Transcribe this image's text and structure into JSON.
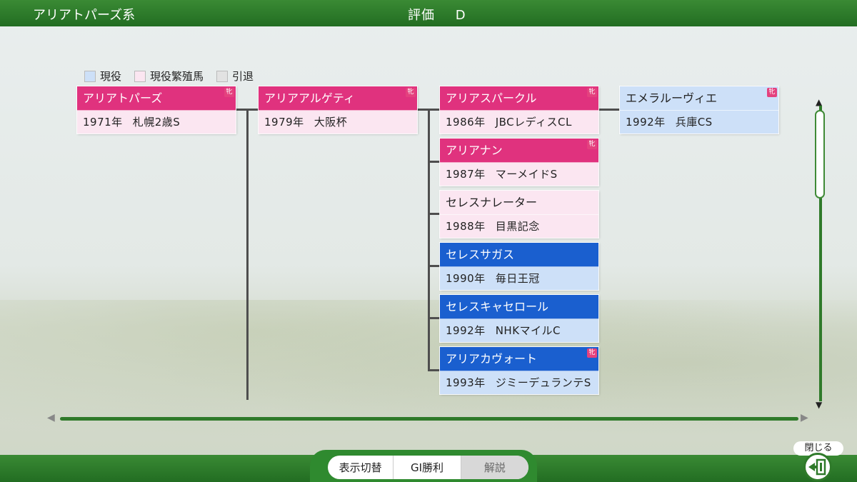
{
  "header": {
    "title": "アリアトパーズ系",
    "rating_label": "評価",
    "rating_grade": "D"
  },
  "legend": [
    {
      "label": "現役",
      "color": "#cde0f8"
    },
    {
      "label": "現役繁殖馬",
      "color": "#fbe6f1"
    },
    {
      "label": "引退",
      "color": "#e2e2e2"
    }
  ],
  "horses": [
    {
      "name": "アリアトパーズ",
      "year": "1971年",
      "race": "札幌2歳S",
      "status": "breeding",
      "badge": "牝"
    },
    {
      "name": "アリアアルゲティ",
      "year": "1979年",
      "race": "大阪杯",
      "status": "breeding",
      "badge": "牝"
    },
    {
      "name": "アリアスパークル",
      "year": "1986年",
      "race": "JBCレディスCL",
      "status": "breeding",
      "badge": "牝"
    },
    {
      "name": "エメラルーヴィエ",
      "year": "1992年",
      "race": "兵庫CS",
      "status": "active",
      "badge": "牝"
    },
    {
      "name": "アリアナン",
      "year": "1987年",
      "race": "マーメイドS",
      "status": "breeding",
      "badge": "牝"
    },
    {
      "name": "セレスナレーター",
      "year": "1988年",
      "race": "目黒記念",
      "status": "breeding"
    },
    {
      "name": "セレスサガス",
      "year": "1990年",
      "race": "毎日王冠",
      "status": "active"
    },
    {
      "name": "セレスキャセロール",
      "year": "1992年",
      "race": "NHKマイルC",
      "status": "active"
    },
    {
      "name": "アリアカヴォート",
      "year": "1993年",
      "race": "ジミーデュランテS",
      "status": "active",
      "badge": "牝"
    }
  ],
  "tabs": [
    {
      "label": "表示切替"
    },
    {
      "label": "GI勝利"
    },
    {
      "label": "解説"
    }
  ],
  "close": {
    "label": "閉じる"
  },
  "icons": {
    "scroll_up": "triangle-up",
    "scroll_down": "triangle-down",
    "scroll_left": "triangle-left",
    "scroll_right": "triangle-right",
    "badge": "female-mark",
    "close": "exit-door-icon"
  }
}
